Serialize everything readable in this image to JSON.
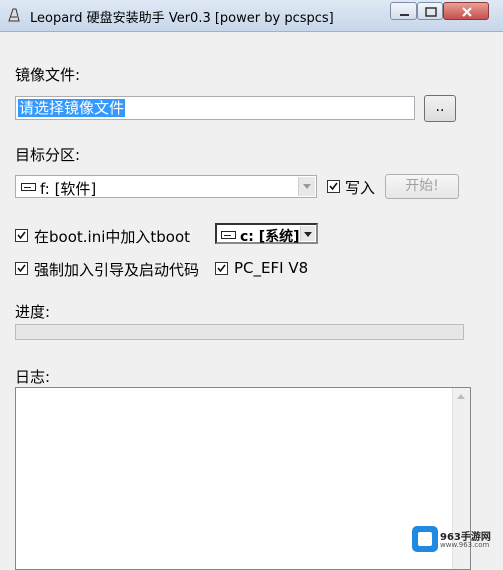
{
  "window": {
    "title": "Leopard 硬盘安装助手 Ver0.3 [power by pcspcs]"
  },
  "image_section": {
    "label": "镜像文件:",
    "value": "请选择镜像文件",
    "browse_label": ".."
  },
  "target_section": {
    "label": "目标分区:",
    "partition": "f: [软件]",
    "write_label": "写入",
    "start_label": "开始!"
  },
  "options": {
    "boot_ini_label": "在boot.ini中加入tboot",
    "boot_drive": "c: [系统]",
    "force_label": "强制加入引导及启动代码",
    "pc_efi_label": "PC_EFI V8"
  },
  "progress": {
    "label": "进度:",
    "value": 0
  },
  "log": {
    "label": "日志:",
    "content": ""
  },
  "watermark": {
    "name": "963手游网",
    "url": "www.963.com"
  }
}
